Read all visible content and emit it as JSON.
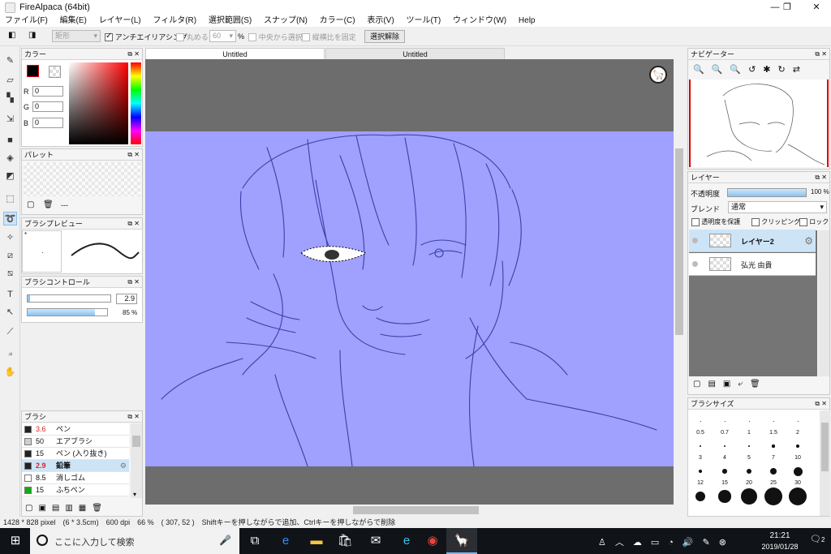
{
  "window": {
    "title": "FireAlpaca (64bit)",
    "min": "—",
    "max": "❐",
    "close": "✕"
  },
  "menu": [
    "ファイル(F)",
    "編集(E)",
    "レイヤー(L)",
    "フィルタ(R)",
    "選択範囲(S)",
    "スナップ(N)",
    "カラー(C)",
    "表示(V)",
    "ツール(T)",
    "ウィンドウ(W)",
    "Help"
  ],
  "options": {
    "shape": "矩形",
    "antialias": "アンチエイリアシング",
    "round": "丸める",
    "round_value": "60",
    "round_unit": "%",
    "center": "中央から選択",
    "fixed_ratio": "縦横比を固定",
    "deselect": "選択解除"
  },
  "tabs": [
    "Untitled",
    "Untitled"
  ],
  "color_panel": {
    "title": "カラー",
    "r_label": "R",
    "g_label": "G",
    "b_label": "B",
    "r": "0",
    "g": "0",
    "b": "0"
  },
  "palette_panel": {
    "title": "パレット",
    "dashes": "---"
  },
  "brush_preview": {
    "title": "ブラシプレビュー",
    "marker": "*"
  },
  "brush_control": {
    "title": "ブラシコントロール",
    "size": "2.9",
    "opacity": "85 %",
    "opacity_value": 0.85
  },
  "brush_panel": {
    "title": "ブラシ",
    "items": [
      {
        "size": "3.6",
        "name": "ペン",
        "color": "#222222"
      },
      {
        "size": "50",
        "name": "エアブラシ",
        "color": "#cfcfcf"
      },
      {
        "size": "15",
        "name": "ペン (入り抜き)",
        "color": "#222222"
      },
      {
        "size": "2.9",
        "name": "鉛筆",
        "color": "#222222"
      },
      {
        "size": "8.5",
        "name": "消しゴム",
        "color": "#ffffff"
      },
      {
        "size": "15",
        "name": "ふちペン",
        "color": "#11aa11"
      }
    ]
  },
  "navigator": {
    "title": "ナビゲーター"
  },
  "layer_panel": {
    "title": "レイヤー",
    "opacity_label": "不透明度",
    "opacity": "100 %",
    "blend_label": "ブレンド",
    "blend": "通常",
    "protect": "透明度を保護",
    "clipping": "クリッピング",
    "lock": "ロック",
    "layers": [
      "レイヤー2",
      "弘光 由貴"
    ]
  },
  "brush_size": {
    "title": "ブラシサイズ",
    "labels": [
      "0.5",
      "0.7",
      "1",
      "1.5",
      "2",
      "3",
      "4",
      "5",
      "7",
      "10",
      "12",
      "15",
      "20",
      "25",
      "30"
    ]
  },
  "status": "1428 * 828 pixel　(6 * 3.5cm)　600 dpi　66 %　( 307, 52 )　Shiftキーを押しながらで追加、Ctrlキーを押しながらで削除",
  "taskbar": {
    "search": "ここに入力して検索",
    "time": "21:21",
    "date": "2019/01/28",
    "notif": "2"
  },
  "colors": {
    "canvas_bg": "#a0a0ff",
    "workspace": "#6d6d6d",
    "accent": "#cde4f7",
    "sketch": "#3b3fa8"
  }
}
